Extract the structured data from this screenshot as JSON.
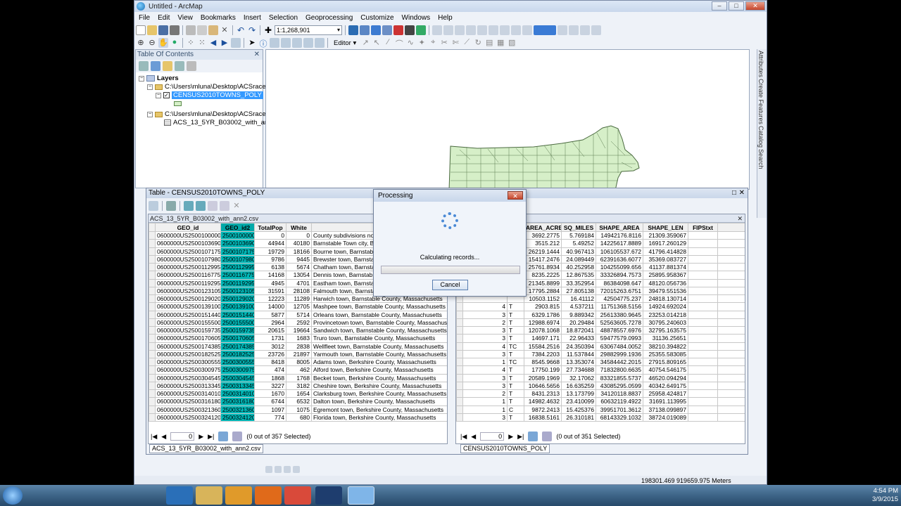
{
  "window": {
    "title": "Untitled - ArcMap"
  },
  "menu": [
    "File",
    "Edit",
    "View",
    "Bookmarks",
    "Insert",
    "Selection",
    "Geoprocessing",
    "Customize",
    "Windows",
    "Help"
  ],
  "scale": "1:1,268,901",
  "editor_label": "Editor ▾",
  "toc": {
    "title": "Table Of Contents",
    "layers_label": "Layers",
    "folder1": "C:\\Users\\mluna\\Desktop\\ACSrace",
    "layer1": "CENSUS2010TOWNS_POLY",
    "folder2": "C:\\Users\\mluna\\Desktop\\ACSrace",
    "table2": "ACS_13_5YR_B03002_with_ann2.c"
  },
  "right_dock": [
    "Attributes",
    "Create Features",
    "Catalog",
    "Search"
  ],
  "table_window": {
    "title": "Table - CENSUS2010TOWNS_POLY",
    "left_pane_title": "ACS_13_5YR_B03002_with_ann2.csv",
    "right_pane_title": "Y",
    "left_columns": [
      "GEO_id",
      "GEO_id2",
      "TotalPop",
      "White",
      ""
    ],
    "left_rows": [
      [
        "0600000US2500100000",
        "2500100000",
        "0",
        "0",
        "County subdivisions not"
      ],
      [
        "0600000US2500103690",
        "2500103690",
        "44944",
        "40180",
        "Barnstable Town city, B"
      ],
      [
        "0600000US2500107175",
        "2500107175",
        "19729",
        "18166",
        "Bourne town, Barnstable"
      ],
      [
        "0600000US2500107980",
        "2500107980",
        "9786",
        "9445",
        "Brewster town, Barnsta"
      ],
      [
        "0600000US2500112995",
        "2500112995",
        "6138",
        "5674",
        "Chatham town, Barnsta"
      ],
      [
        "0600000US2500116775",
        "2500116775",
        "14168",
        "13054",
        "Dennis town, Barnstab"
      ],
      [
        "0600000US2500119295",
        "2500119295",
        "4945",
        "4701",
        "Eastham town, Barnstab"
      ],
      [
        "0600000US2500123105",
        "2500123105",
        "31591",
        "28108",
        "Falmouth town, Barnstab"
      ],
      [
        "0600000US2500129020",
        "2500129020",
        "12223",
        "11289",
        "Harwich town, Barnstable County, Massachusetts"
      ],
      [
        "0600000US2500139100",
        "2500139100",
        "14000",
        "12705",
        "Mashpee town, Barnstable County, Massachusetts"
      ],
      [
        "0600000US2500151440",
        "2500151440",
        "5877",
        "5714",
        "Orleans town, Barnstable County, Massachusetts"
      ],
      [
        "0600000US2500155500",
        "2500155500",
        "2964",
        "2592",
        "Provincetown town, Barnstable County, Massachuset"
      ],
      [
        "0600000US2500159735",
        "2500159735",
        "20615",
        "19664",
        "Sandwich town, Barnstable County, Massachusetts"
      ],
      [
        "0600000US2500170605",
        "2500170605",
        "1731",
        "1683",
        "Truro town, Barnstable County, Massachusetts"
      ],
      [
        "0600000US2500174385",
        "2500174385",
        "3012",
        "2838",
        "Wellfleet town, Barnstable County, Massachusetts"
      ],
      [
        "0600000US2500182525",
        "2500182525",
        "23726",
        "21897",
        "Yarmouth town, Barnstable County, Massachusetts"
      ],
      [
        "0600000US2500300555",
        "2500300555",
        "8418",
        "8005",
        "Adams town, Berkshire County, Massachusetts"
      ],
      [
        "0600000US2500300975",
        "2500300975",
        "474",
        "462",
        "Alford town, Berkshire County, Massachusetts"
      ],
      [
        "0600000US2500304545",
        "2500304545",
        "1868",
        "1768",
        "Becket town, Berkshire County, Massachusetts"
      ],
      [
        "0600000US2500313345",
        "2500313345",
        "3227",
        "3182",
        "Cheshire town, Berkshire County, Massachusetts"
      ],
      [
        "0600000US2500314010",
        "2500314010",
        "1670",
        "1654",
        "Clarksburg town, Berkshire County, Massachusetts"
      ],
      [
        "0600000US2500316180",
        "2500316180",
        "6744",
        "6532",
        "Dalton town, Berkshire County, Massachusetts"
      ],
      [
        "0600000US2500321360",
        "2500321360",
        "1097",
        "1075",
        "Egremont town, Berkshire County, Massachusetts"
      ],
      [
        "0600000US2500324120",
        "2500324120",
        "774",
        "680",
        "Florida town, Berkshire County, Massachusetts"
      ]
    ],
    "right_columns": [
      "",
      "",
      "AREA_ACRES",
      "SQ_MILES",
      "SHAPE_AREA",
      "SHAPE_LEN",
      "FIPStxt"
    ],
    "right_rows": [
      [
        "",
        "",
        "3692.2775",
        "5.769184",
        "14942176.8116",
        "21309.359067",
        ""
      ],
      [
        "",
        "",
        "3515.212",
        "5.49252",
        "14225617.8889",
        "16917.260129",
        ""
      ],
      [
        "",
        "",
        "26219.1444",
        "40.967413",
        "106105537.672",
        "41796.414828",
        ""
      ],
      [
        "",
        "",
        "15417.2476",
        "24.089449",
        "62391636.6077",
        "35369.083727",
        ""
      ],
      [
        "",
        "",
        "25761.8934",
        "40.252958",
        "104255099.656",
        "41137.881374",
        ""
      ],
      [
        "",
        "",
        "8235.2225",
        "12.867535",
        "33326894.7573",
        "25895.958367",
        ""
      ],
      [
        "",
        "",
        "21345.8899",
        "33.352954",
        "86384098.647",
        "48120.056736",
        ""
      ],
      [
        "",
        "",
        "17795.2884",
        "27.805138",
        "72015263.6751",
        "39479.551536",
        ""
      ],
      [
        "",
        "",
        "10503.1152",
        "16.41112",
        "42504775.237",
        "24818.130714",
        ""
      ],
      [
        "4",
        "T",
        "2903.815",
        "4.537211",
        "11751368.5156",
        "14924.692024",
        ""
      ],
      [
        "3",
        "T",
        "6329.1786",
        "9.889342",
        "25613380.9645",
        "23253.014218",
        ""
      ],
      [
        "2",
        "T",
        "12988.6974",
        "20.29484",
        "52563605.7278",
        "30795.240603",
        ""
      ],
      [
        "3",
        "T",
        "12078.1068",
        "18.872041",
        "48878557.6976",
        "32795.163575",
        ""
      ],
      [
        "3",
        "T",
        "14697.171",
        "22.96433",
        "59477579.0993",
        "31136.25651",
        ""
      ],
      [
        "4",
        "TC",
        "15584.2516",
        "24.350394",
        "63067484.0052",
        "38210.394822",
        ""
      ],
      [
        "3",
        "T",
        "7384.2203",
        "11.537844",
        "29882999.1936",
        "25355.583085",
        ""
      ],
      [
        "1",
        "TC",
        "8545.9668",
        "13.353074",
        "34584442.2015",
        "27915.809165",
        ""
      ],
      [
        "4",
        "T",
        "17750.199",
        "27.734688",
        "71832800.6635",
        "40754.546175",
        ""
      ],
      [
        "3",
        "T",
        "20589.1969",
        "32.17062",
        "83321855.5737",
        "46520.094294",
        ""
      ],
      [
        "3",
        "T",
        "10646.5656",
        "16.635259",
        "43085295.0599",
        "40342.649175",
        ""
      ],
      [
        "2",
        "T",
        "8431.2313",
        "13.173799",
        "34120118.8837",
        "25958.424817",
        ""
      ],
      [
        "1",
        "T",
        "14982.4632",
        "23.410099",
        "60632119.4922",
        "31691.113995",
        ""
      ],
      [
        "1",
        "C",
        "9872.2413",
        "15.425376",
        "39951701.3612",
        "37138.099897",
        ""
      ],
      [
        "3",
        "T",
        "16838.5161",
        "26.310181",
        "68143329.1032",
        "38724.019089",
        ""
      ]
    ],
    "left_nav": {
      "record": "0",
      "status": "(0 out of 357 Selected)"
    },
    "right_nav": {
      "record": "0",
      "status": "(0 out of 351 Selected)"
    },
    "left_tab": "ACS_13_5YR_B03002_with_ann2.csv",
    "right_tab": "CENSUS2010TOWNS_POLY"
  },
  "dialog": {
    "title": "Processing",
    "message": "Calculating records...",
    "cancel": "Cancel"
  },
  "status": {
    "coords": "198301.469  919659.975 Meters"
  },
  "taskbar": {
    "time": "4:54 PM",
    "date": "3/9/2015"
  },
  "colors": {
    "selection_cyan": "#00b7b7",
    "map_fill": "#d6efc8",
    "toc_highlight": "#3399ff"
  }
}
